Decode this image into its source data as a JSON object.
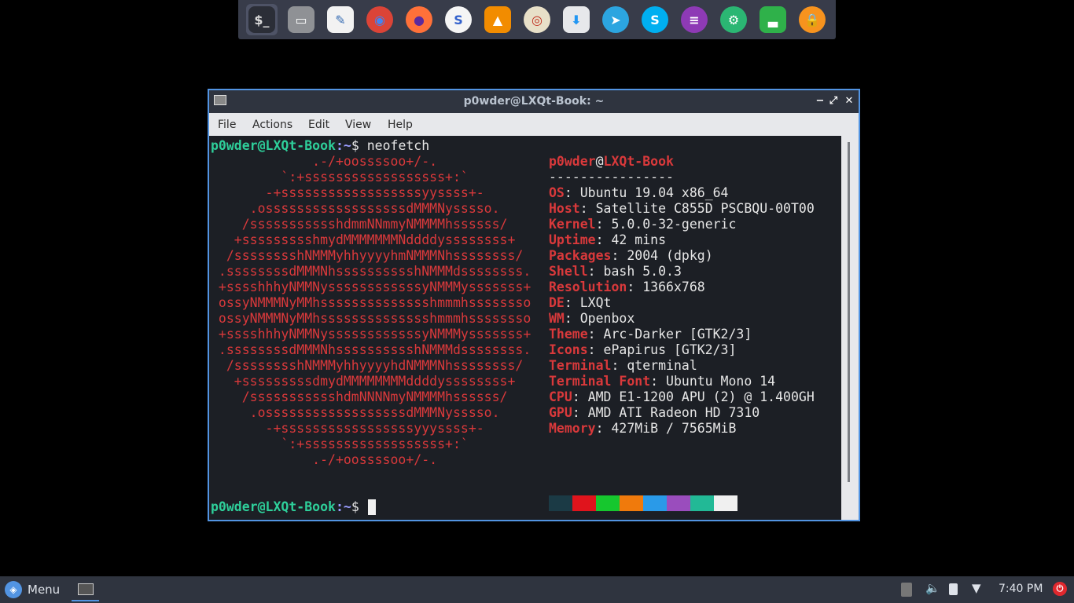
{
  "dock": {
    "items": [
      {
        "name": "terminal",
        "glyph": "$_",
        "bg": "#2b2e37",
        "fg": "#dddddd"
      },
      {
        "name": "file-manager",
        "glyph": "▭",
        "bg": "#8f9195",
        "fg": "#ffffff"
      },
      {
        "name": "text-editor",
        "glyph": "✎",
        "bg": "#f2f2f2",
        "fg": "#3a6fb5"
      },
      {
        "name": "chrome",
        "glyph": "◉",
        "bg": "#db4437",
        "fg": "#4285f4"
      },
      {
        "name": "firefox",
        "glyph": "●",
        "bg": "#ff7139",
        "fg": "#5c2a9d"
      },
      {
        "name": "simplenote",
        "glyph": "S",
        "bg": "#f5f5f5",
        "fg": "#3361cc"
      },
      {
        "name": "vlc",
        "glyph": "▲",
        "bg": "#f28c00",
        "fg": "#ffffff"
      },
      {
        "name": "rhythmbox",
        "glyph": "◎",
        "bg": "#e8e0c8",
        "fg": "#c03020"
      },
      {
        "name": "software-center",
        "glyph": "⬇",
        "bg": "#e7e8eb",
        "fg": "#2196f3"
      },
      {
        "name": "telegram",
        "glyph": "➤",
        "bg": "#2ca5e0",
        "fg": "#ffffff"
      },
      {
        "name": "skype",
        "glyph": "S",
        "bg": "#00aff0",
        "fg": "#ffffff"
      },
      {
        "name": "chat",
        "glyph": "≡",
        "bg": "#8e3ab5",
        "fg": "#ffffff"
      },
      {
        "name": "settings",
        "glyph": "⚙",
        "bg": "#2bb673",
        "fg": "#ffffff"
      },
      {
        "name": "system-monitor",
        "glyph": "▃",
        "bg": "#2fb14a",
        "fg": "#ffffff"
      },
      {
        "name": "lock",
        "glyph": "🔒",
        "bg": "#f7931e",
        "fg": "#ffffff"
      }
    ]
  },
  "window": {
    "title": "p0wder@LXQt-Book: ~",
    "menu": [
      "File",
      "Actions",
      "Edit",
      "View",
      "Help"
    ],
    "minimize": "−",
    "maximize": "⤢",
    "close": "✕"
  },
  "terminal": {
    "prompt_user": "p0wder@LXQt-Book",
    "prompt_path": ":~",
    "prompt_symbol": "$ ",
    "command": "neofetch",
    "ascii": [
      "             .-/+oossssoo+/-.",
      "         `:+ssssssssssssssssss+:`",
      "       -+ssssssssssssssssssyyssss+-",
      "     .ossssssssssssssssssdMMMNysssso.",
      "    /ssssssssssshdmmNNmmyNMMMMhssssss/",
      "   +ssssssssshmydMMMMMMMNddddyssssssss+",
      "  /sssssssshNMMMyhhyyyyhmNMMMNhssssssss/",
      " .ssssssssdMMMNhsssssssssshNMMMdssssssss.",
      " +sssshhhyNMMNyssssssssssssyNMMMysssssss+",
      " ossyNMMMNyMMhsssssssssssssshmmmhssssssso",
      " ossyNMMMNyMMhsssssssssssssshmmmhssssssso",
      " +sssshhhyNMMNyssssssssssssyNMMMysssssss+",
      " .ssssssssdMMMNhsssssssssshNMMMdssssssss.",
      "  /sssssssshNMMMyhhyyyyhdNMMMNhssssssss/",
      "   +sssssssssdmydMMMMMMMMddddyssssssss+",
      "    /ssssssssssshdmNNNNmyNMMMMhssssss/",
      "     .ossssssssssssssssssdMMMNysssso.",
      "       -+sssssssssssssssssyyyssss+-",
      "         `:+ssssssssssssssssss+:`",
      "             .-/+oossssoo+/-."
    ],
    "header_user": "p0wder",
    "header_at": "@",
    "header_host": "LXQt-Book",
    "separator": "----------------",
    "info": [
      {
        "label": "OS",
        "value": "Ubuntu 19.04 x86_64"
      },
      {
        "label": "Host",
        "value": "Satellite C855D PSCBQU-00T00"
      },
      {
        "label": "Kernel",
        "value": "5.0.0-32-generic"
      },
      {
        "label": "Uptime",
        "value": "42 mins"
      },
      {
        "label": "Packages",
        "value": "2004 (dpkg)"
      },
      {
        "label": "Shell",
        "value": "bash 5.0.3"
      },
      {
        "label": "Resolution",
        "value": "1366x768"
      },
      {
        "label": "DE",
        "value": "LXQt"
      },
      {
        "label": "WM",
        "value": "Openbox"
      },
      {
        "label": "Theme",
        "value": "Arc-Darker [GTK2/3]"
      },
      {
        "label": "Icons",
        "value": "ePapirus [GTK2/3]"
      },
      {
        "label": "Terminal",
        "value": "qterminal"
      },
      {
        "label": "Terminal Font",
        "value": "Ubuntu Mono 14"
      },
      {
        "label": "CPU",
        "value": "AMD E1-1200 APU (2) @ 1.400GH"
      },
      {
        "label": "GPU",
        "value": "AMD ATI Radeon HD 7310"
      },
      {
        "label": "Memory",
        "value": "427MiB / 7565MiB"
      }
    ],
    "colors": [
      "#1b3a45",
      "#e0141c",
      "#16c72e",
      "#f07a0c",
      "#2a9ae8",
      "#9a4dbd",
      "#22b996",
      "#f0f0f0"
    ]
  },
  "taskbar": {
    "menu_label": "Menu",
    "clock": "7:40 PM"
  }
}
